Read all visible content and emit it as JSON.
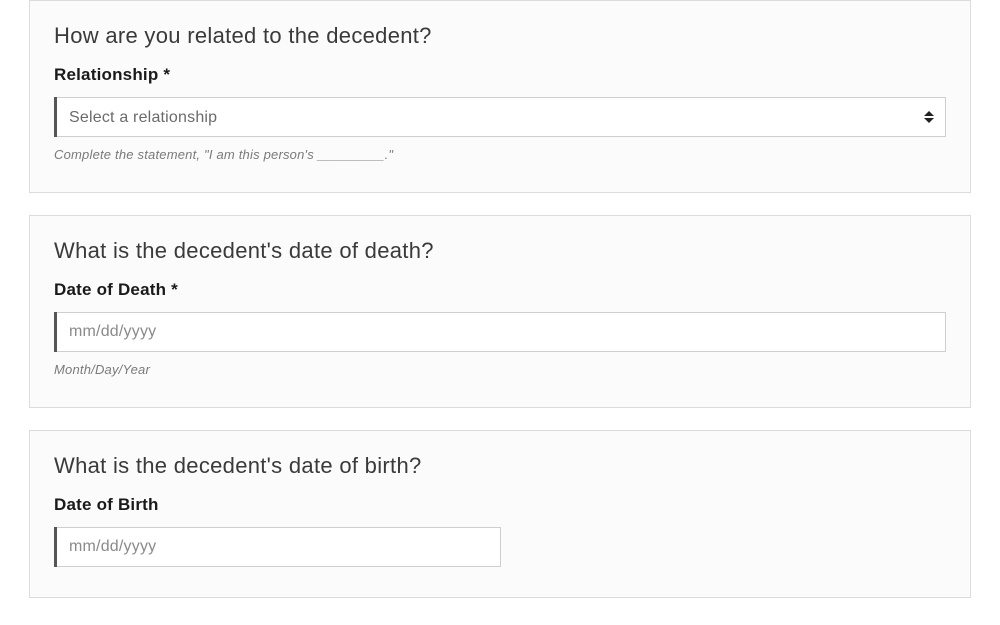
{
  "section1": {
    "heading": "How are you related to the decedent?",
    "label": "Relationship *",
    "selectPlaceholder": "Select a relationship",
    "help": "Complete the statement, \"I am this person's _________.\""
  },
  "section2": {
    "heading": "What is the decedent's date of death?",
    "label": "Date of Death *",
    "placeholder": "mm/dd/yyyy",
    "help": "Month/Day/Year"
  },
  "section3": {
    "heading": "What is the decedent's date of birth?",
    "label": "Date of Birth",
    "placeholder": "mm/dd/yyyy"
  }
}
